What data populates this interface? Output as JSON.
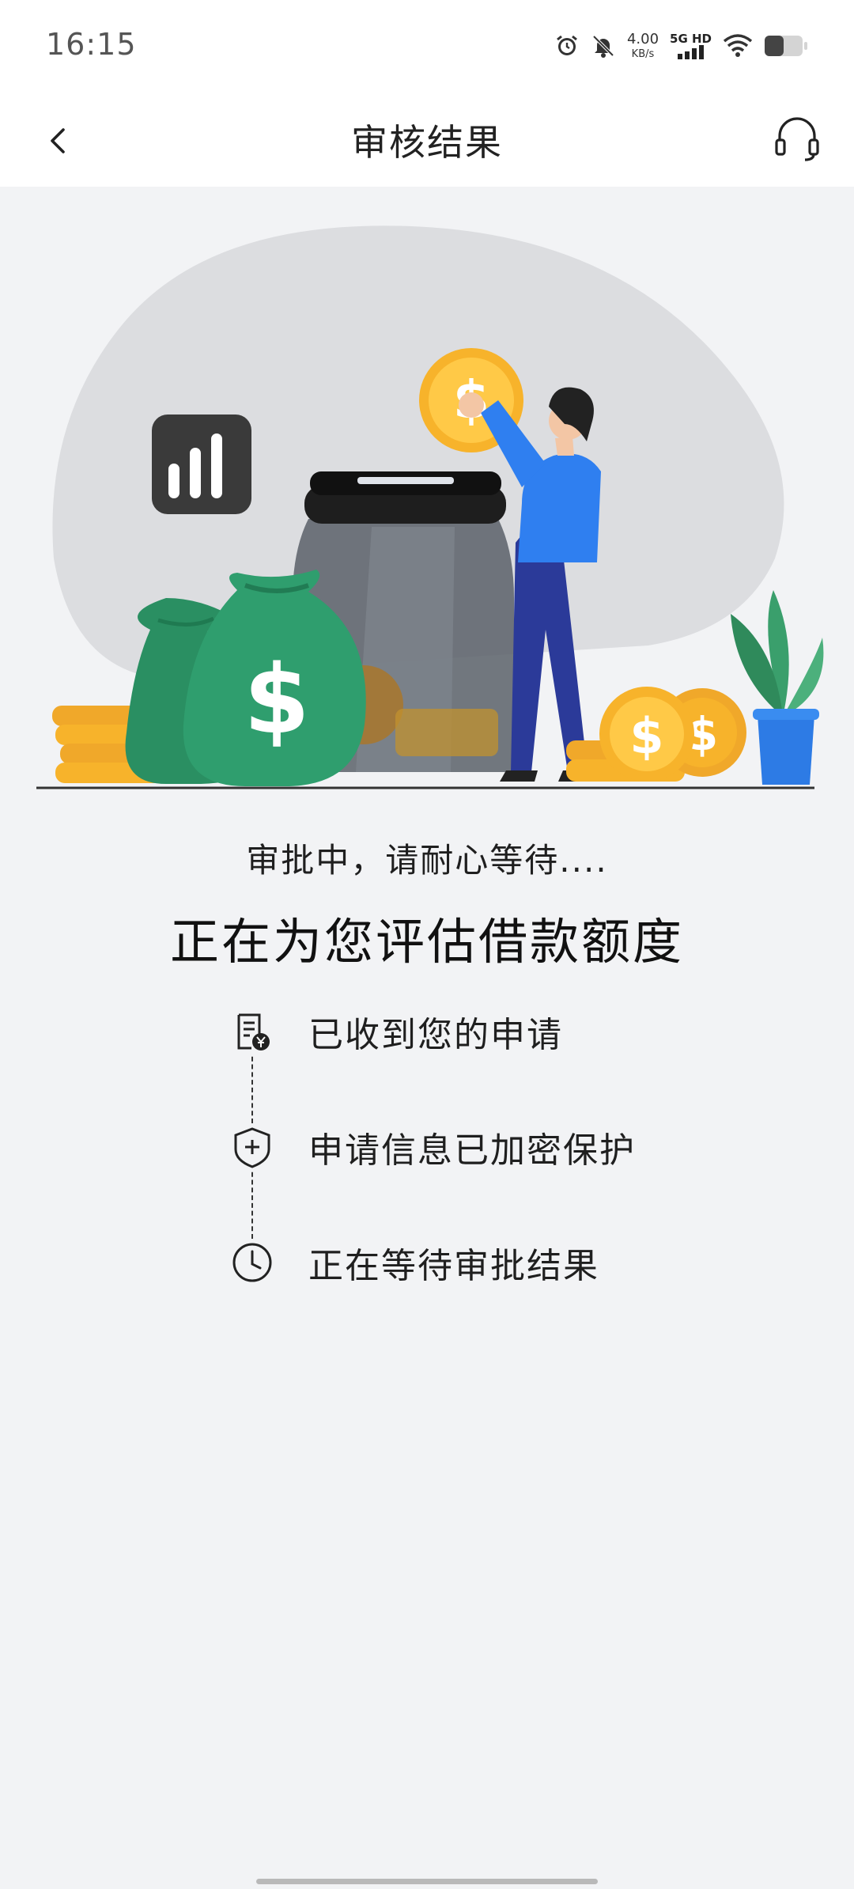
{
  "status_bar": {
    "time": "16:15",
    "net_speed_value": "4.00",
    "net_speed_unit": "KB/s",
    "network_type": "5G HD",
    "icons": [
      "alarm-icon",
      "bell-muted-icon",
      "signal-icon",
      "wifi-icon",
      "battery-icon"
    ]
  },
  "nav": {
    "title": "审核结果",
    "back_icon": "chevron-left-icon",
    "support_icon": "headset-icon"
  },
  "main": {
    "status_text": "审批中，请耐心等待....",
    "headline": "正在为您评估借款额度"
  },
  "steps": [
    {
      "icon": "receipt-yen-icon",
      "label": "已收到您的申请"
    },
    {
      "icon": "shield-plus-icon",
      "label": "申请信息已加密保护"
    },
    {
      "icon": "clock-icon",
      "label": "正在等待审批结果"
    }
  ],
  "illustration": {
    "coin_symbol": "$",
    "colors": {
      "blob": "#dcdde0",
      "money_bag": "#2f9e6e",
      "coin": "#f7b32b",
      "person_shirt": "#2f7ff0",
      "person_pants": "#2b3a99",
      "jar_lid": "#1e1e1e",
      "plant": "#3a9f6c",
      "pot": "#2d7be5"
    }
  }
}
